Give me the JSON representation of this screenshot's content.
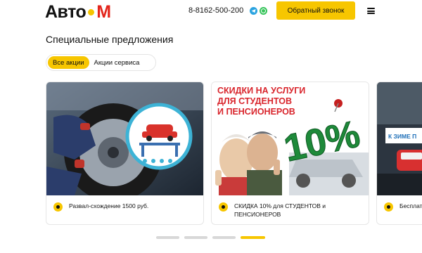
{
  "header": {
    "logo_left": "Авто",
    "logo_right": "М",
    "phone": "8-8162-500-200",
    "callback_label": "Обратный звонок",
    "icons": [
      "telegram-icon",
      "whatsapp-icon",
      "menu-icon"
    ]
  },
  "main": {
    "title": "Специальные предложения",
    "tabs": [
      {
        "label": "Все акции",
        "active": true
      },
      {
        "label": "Акции сервиса",
        "active": false
      }
    ],
    "cards": [
      {
        "caption": "Развал-схождение 1500 руб."
      },
      {
        "caption": "СКИДКА 10% для СТУДЕНТОВ и ПЕНСИОНЕРОВ",
        "image_text": [
          "СКИДКИ НА УСЛУГИ",
          "ДЛЯ СТУДЕНТОВ",
          "И ПЕНСИОНЕРОВ",
          "10%"
        ]
      },
      {
        "caption": "Бесплат",
        "image_text": [
          "К ЗИМЕ П"
        ]
      }
    ],
    "pager": {
      "count": 4,
      "active_index": 3
    }
  },
  "colors": {
    "accent": "#f7c600",
    "brand_red": "#e3251b"
  }
}
